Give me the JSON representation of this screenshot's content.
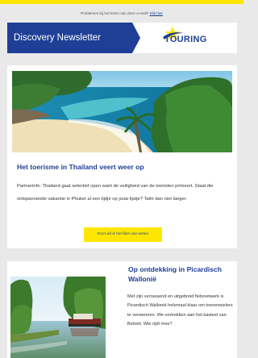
{
  "preheader": {
    "text": "Problemen bij het lezen van deze e-mail? ",
    "link_label": "Klik hier"
  },
  "banner": {
    "title": "Discovery Newsletter",
    "logo_text": "TOURING"
  },
  "article1": {
    "title": "Het toerisme in Thailand veert weer op",
    "body": "Partnerinfo: Thailand gaat selectief open want de veiligheid van de toeristen primeert. Staat die ontspannende vakantie in Phuket al een tijdje op jouw lijstje? Talm dan niet langer.",
    "cta_label": "Door wil ik het fijne van weten"
  },
  "article2": {
    "title": "Op ontdekking in Picardisch Wallonië",
    "body": "Met zijn verrassend en uitgebreid fietsnetwerk is Picardisch Wallonië helemaal klaar om toerenwielers te verwennen. We vertrekken aan het kasteel van Beloeil. Wie rijdt mee?"
  },
  "colors": {
    "brand_blue": "#1f3f97",
    "brand_yellow": "#ffe600",
    "page_bg": "#e9e9e9"
  }
}
